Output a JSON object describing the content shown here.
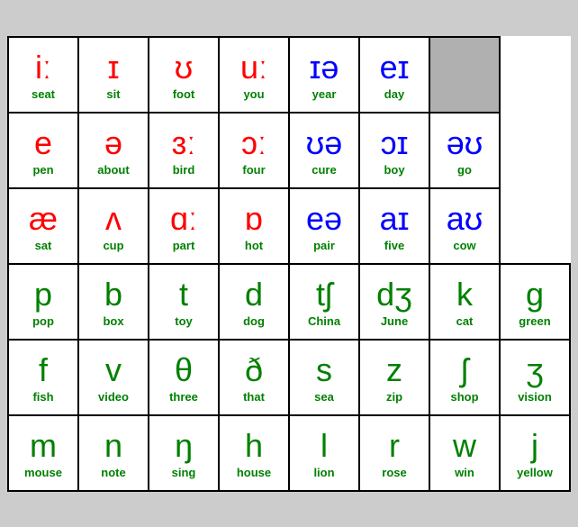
{
  "rows": [
    {
      "type": "vowel",
      "cells": [
        {
          "symbol": "iː",
          "word": "seat",
          "symColor": "red",
          "wordColor": "green"
        },
        {
          "symbol": "ɪ",
          "word": "sit",
          "symColor": "red",
          "wordColor": "green"
        },
        {
          "symbol": "ʊ",
          "word": "foot",
          "symColor": "red",
          "wordColor": "green"
        },
        {
          "symbol": "uː",
          "word": "you",
          "symColor": "red",
          "wordColor": "green"
        },
        {
          "symbol": "ɪə",
          "word": "year",
          "symColor": "blue",
          "wordColor": "green"
        },
        {
          "symbol": "eɪ",
          "word": "day",
          "symColor": "blue",
          "wordColor": "green"
        },
        {
          "symbol": "",
          "word": "",
          "symColor": "",
          "wordColor": "",
          "gray": true
        }
      ]
    },
    {
      "type": "vowel",
      "cells": [
        {
          "symbol": "e",
          "word": "pen",
          "symColor": "red",
          "wordColor": "green"
        },
        {
          "symbol": "ə",
          "word": "about",
          "symColor": "red",
          "wordColor": "green"
        },
        {
          "symbol": "ɜː",
          "word": "bird",
          "symColor": "red",
          "wordColor": "green"
        },
        {
          "symbol": "ɔː",
          "word": "four",
          "symColor": "red",
          "wordColor": "green"
        },
        {
          "symbol": "ʊə",
          "word": "cure",
          "symColor": "blue",
          "wordColor": "green"
        },
        {
          "symbol": "ɔɪ",
          "word": "boy",
          "symColor": "blue",
          "wordColor": "green"
        },
        {
          "symbol": "əʊ",
          "word": "go",
          "symColor": "blue",
          "wordColor": "green"
        }
      ]
    },
    {
      "type": "vowel",
      "cells": [
        {
          "symbol": "æ",
          "word": "sat",
          "symColor": "red",
          "wordColor": "green"
        },
        {
          "symbol": "ʌ",
          "word": "cup",
          "symColor": "red",
          "wordColor": "green"
        },
        {
          "symbol": "ɑː",
          "word": "part",
          "symColor": "red",
          "wordColor": "green"
        },
        {
          "symbol": "ɒ",
          "word": "hot",
          "symColor": "red",
          "wordColor": "green"
        },
        {
          "symbol": "eə",
          "word": "pair",
          "symColor": "blue",
          "wordColor": "green"
        },
        {
          "symbol": "aɪ",
          "word": "five",
          "symColor": "blue",
          "wordColor": "green"
        },
        {
          "symbol": "aʊ",
          "word": "cow",
          "symColor": "blue",
          "wordColor": "green"
        }
      ]
    },
    {
      "type": "consonant",
      "cells": [
        {
          "symbol": "p",
          "word": "pop",
          "symColor": "green",
          "wordColor": "green"
        },
        {
          "symbol": "b",
          "word": "box",
          "symColor": "green",
          "wordColor": "green"
        },
        {
          "symbol": "t",
          "word": "toy",
          "symColor": "green",
          "wordColor": "green"
        },
        {
          "symbol": "d",
          "word": "dog",
          "symColor": "green",
          "wordColor": "green"
        },
        {
          "symbol": "tʃ",
          "word": "China",
          "symColor": "green",
          "wordColor": "green"
        },
        {
          "symbol": "dʒ",
          "word": "June",
          "symColor": "green",
          "wordColor": "green"
        },
        {
          "symbol": "k",
          "word": "cat",
          "symColor": "green",
          "wordColor": "green"
        },
        {
          "symbol": "g",
          "word": "green",
          "symColor": "green",
          "wordColor": "green"
        }
      ]
    },
    {
      "type": "consonant",
      "cells": [
        {
          "symbol": "f",
          "word": "fish",
          "symColor": "green",
          "wordColor": "green"
        },
        {
          "symbol": "v",
          "word": "video",
          "symColor": "green",
          "wordColor": "green"
        },
        {
          "symbol": "θ",
          "word": "three",
          "symColor": "green",
          "wordColor": "green"
        },
        {
          "symbol": "ð",
          "word": "that",
          "symColor": "green",
          "wordColor": "green"
        },
        {
          "symbol": "s",
          "word": "sea",
          "symColor": "green",
          "wordColor": "green"
        },
        {
          "symbol": "z",
          "word": "zip",
          "symColor": "green",
          "wordColor": "green"
        },
        {
          "symbol": "ʃ",
          "word": "shop",
          "symColor": "green",
          "wordColor": "green"
        },
        {
          "symbol": "ʒ",
          "word": "vision",
          "symColor": "green",
          "wordColor": "green"
        }
      ]
    },
    {
      "type": "consonant",
      "cells": [
        {
          "symbol": "m",
          "word": "mouse",
          "symColor": "green",
          "wordColor": "green"
        },
        {
          "symbol": "n",
          "word": "note",
          "symColor": "green",
          "wordColor": "green"
        },
        {
          "symbol": "ŋ",
          "word": "sing",
          "symColor": "green",
          "wordColor": "green"
        },
        {
          "symbol": "h",
          "word": "house",
          "symColor": "green",
          "wordColor": "green"
        },
        {
          "symbol": "l",
          "word": "lion",
          "symColor": "green",
          "wordColor": "green"
        },
        {
          "symbol": "r",
          "word": "rose",
          "symColor": "green",
          "wordColor": "green"
        },
        {
          "symbol": "w",
          "word": "win",
          "symColor": "green",
          "wordColor": "green"
        },
        {
          "symbol": "j",
          "word": "yellow",
          "symColor": "green",
          "wordColor": "green"
        }
      ]
    }
  ]
}
